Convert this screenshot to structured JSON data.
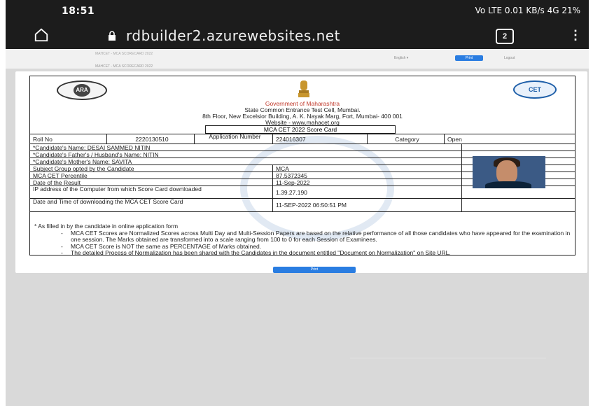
{
  "status": {
    "time": "18:51",
    "icons_text": "Vo LTE  0.01 KB/s  4G  21%"
  },
  "browser": {
    "url": "rdbuilder2.azurewebsites.net",
    "tab_count": "2"
  },
  "site": {
    "crumb_top": "MAHCET - MCA SCORECARD 2022",
    "crumb_bottom": "MAHCET - MCA SCORECARD 2022",
    "language": "English ▾",
    "print_small": "Print",
    "logout": "Logout"
  },
  "card": {
    "logo_left": "ARA",
    "logo_right": "CET",
    "gov": "Government of Maharashtra",
    "cell": "State Common Entrance Test Cell, Mumbai.",
    "address": "8th Floor, New Excelsior Building, A. K. Nayak Marg, Fort, Mumbai- 400 001",
    "website": "Website - www.mahacet.org",
    "title": "MCA CET 2022 Score Card",
    "roll_label": "Roll No",
    "roll_value": "2220130510",
    "app_label": "Application Number",
    "app_value": "224016307",
    "category_label": "Category",
    "category_value": "Open",
    "name": "*Candidate's Name: DESAI SAMMED NITIN",
    "father": "*Candidate's Father's / Husband's Name: NITIN",
    "mother": "*Candidate's Mother's Name: SAVITA",
    "subject_label": "Subject Group opted by the Candidate",
    "subject_value": "MCA",
    "percentile_label": "MCA CET Percentile",
    "percentile_value": "87.5372345",
    "result_date_label": "Date of the Result",
    "result_date_value": "11-Sep-2022",
    "ip_label": "IP address of the Computer from which Score Card downloaded",
    "ip_value": "1.39.27.190",
    "download_label": "Date and Time of downloading the MCA CET Score Card",
    "download_value": "11-SEP-2022 06:50:51 PM",
    "note_intro": "* As filled in by the candidate in online application form",
    "note1": "MCA CET Scores are Normalized Scores across Multi Day and Multi-Session Papers are based on the relative performance of all those candidates who have appeared for the examination in one session. The Marks obtained are transformed into a scale ranging from 100 to 0 for each Session of Examinees.",
    "note2": "MCA CET Score is NOT the same as PERCENTAGE of Marks obtained.",
    "note3": "The detailed Process of Normalization has been shared with the Candidates in the document entitled \"Document on Normalization\" on Site URL."
  },
  "print_button": "Print"
}
